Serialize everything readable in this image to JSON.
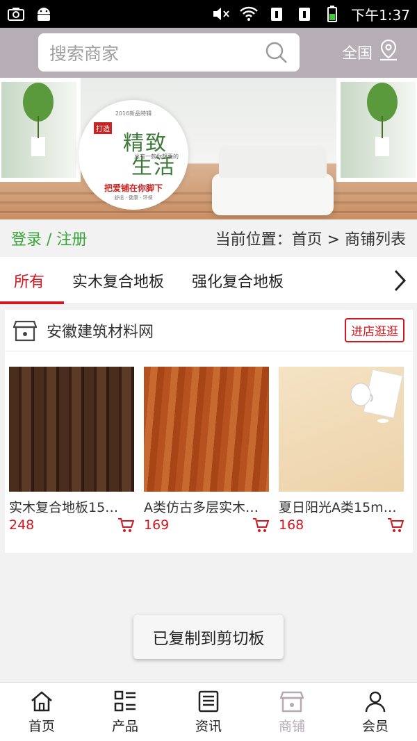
{
  "statusbar": {
    "time": "下午1:37",
    "icons": [
      "screenshot-icon",
      "android-icon",
      "mute-icon",
      "wifi-icon",
      "sim1-icon",
      "sim2-icon",
      "battery-icon"
    ]
  },
  "header": {
    "search_placeholder": "搜索商家",
    "region_label": "全国"
  },
  "banner": {
    "year_text": "2016新品特辑",
    "tag": "打造",
    "title_line1": "精致",
    "title_line2": "生活",
    "small_text": "总有一款你想要的",
    "slogan": "把爱铺在你脚下",
    "tags_text": "舒适 · 健康 · 环保"
  },
  "crumb": {
    "login_text": "登录 / 注册",
    "location_text": "当前位置：首页 > 商铺列表"
  },
  "tabs": [
    {
      "label": "所有",
      "active": true
    },
    {
      "label": "实木复合地板",
      "active": false
    },
    {
      "label": "强化复合地板",
      "active": false
    }
  ],
  "shop": {
    "name": "安徽建筑材料网",
    "enter_label": "进店逛逛",
    "products": [
      {
        "name": "实木复合地板15…",
        "price": "248"
      },
      {
        "name": "A类仿古多层实木…",
        "price": "169"
      },
      {
        "name": "夏日阳光A类15m…",
        "price": "168"
      }
    ]
  },
  "toast": "已复制到剪切板",
  "bottomnav": [
    {
      "label": "首页",
      "icon": "home-icon",
      "active": false
    },
    {
      "label": "产品",
      "icon": "grid-list-icon",
      "active": false
    },
    {
      "label": "资讯",
      "icon": "news-icon",
      "active": false
    },
    {
      "label": "商铺",
      "icon": "shop-icon",
      "active": true
    },
    {
      "label": "会员",
      "icon": "user-icon",
      "active": false
    }
  ],
  "colors": {
    "accent_red": "#d4171f",
    "login_green": "#3aa53a",
    "header_bg": "#b7adb4"
  }
}
